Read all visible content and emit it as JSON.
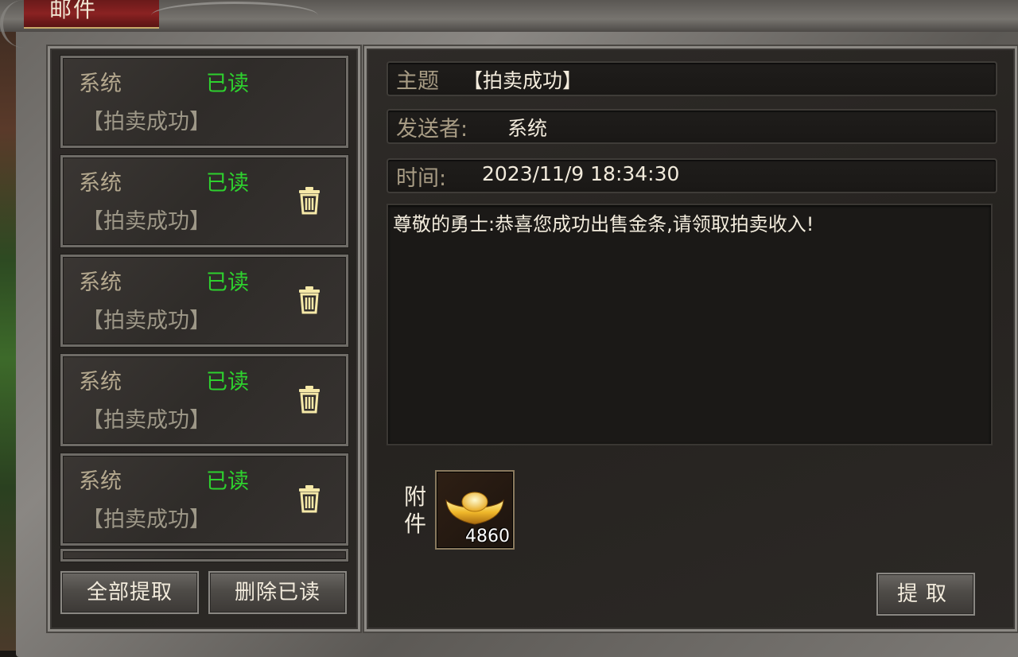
{
  "window": {
    "title": "邮件"
  },
  "mail_list": {
    "items": [
      {
        "sender": "系统",
        "status": "已读",
        "subject": "【拍卖成功】",
        "has_delete": false
      },
      {
        "sender": "系统",
        "status": "已读",
        "subject": "【拍卖成功】",
        "has_delete": true
      },
      {
        "sender": "系统",
        "status": "已读",
        "subject": "【拍卖成功】",
        "has_delete": true
      },
      {
        "sender": "系统",
        "status": "已读",
        "subject": "【拍卖成功】",
        "has_delete": true
      },
      {
        "sender": "系统",
        "status": "已读",
        "subject": "【拍卖成功】",
        "has_delete": true
      }
    ],
    "buttons": {
      "take_all": "全部提取",
      "delete_read": "删除已读"
    }
  },
  "detail": {
    "subject_label": "主题",
    "subject_value": "【拍卖成功】",
    "sender_label": "发送者:",
    "sender_value": "系统",
    "time_label": "时间:",
    "time_value": "2023/11/9 18:34:30",
    "body": "尊敬的勇士:恭喜您成功出售金条,请领取拍卖收入!",
    "attachment_label": "附件",
    "attachment": {
      "icon": "gold-ingot-icon",
      "count": "4860"
    },
    "take_button": "提取"
  },
  "colors": {
    "read_status": "#2ed12e",
    "label": "#a89c84",
    "value": "#f2ebdc"
  }
}
